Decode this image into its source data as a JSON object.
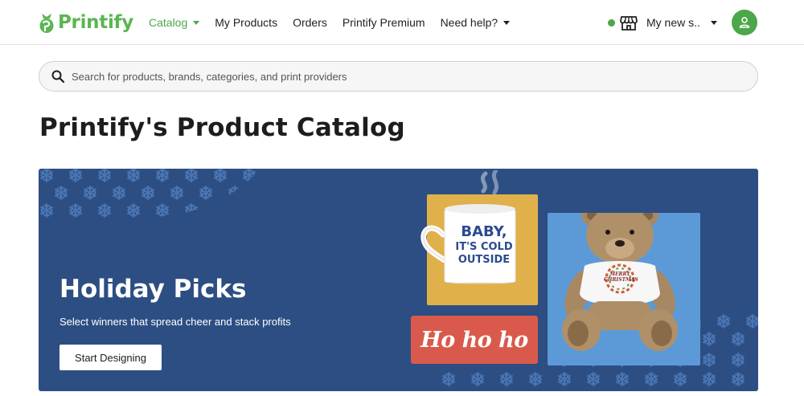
{
  "brand": {
    "name": "Printify",
    "color": "#5ab552"
  },
  "nav": {
    "items": [
      {
        "label": "Catalog",
        "has_menu": true,
        "active": true
      },
      {
        "label": "My Products",
        "has_menu": false,
        "active": false
      },
      {
        "label": "Orders",
        "has_menu": false,
        "active": false
      },
      {
        "label": "Printify Premium",
        "has_menu": false,
        "active": false
      },
      {
        "label": "Need help?",
        "has_menu": true,
        "active": false
      }
    ]
  },
  "store": {
    "name": "My new s...",
    "status_color": "#4ca74a",
    "icon": "storefront-icon"
  },
  "account": {
    "icon": "user-icon",
    "color": "#4ca74a"
  },
  "search": {
    "placeholder": "Search for products, brands, categories, and print providers",
    "value": ""
  },
  "page": {
    "title": "Printify's Product Catalog"
  },
  "banner": {
    "title": "Holiday Picks",
    "subtitle": "Select winners that spread cheer and stack profits",
    "cta_label": "Start Designing",
    "background": "#2d4e83",
    "mug_text": [
      "BABY,",
      "IT'S COLD",
      "OUTSIDE"
    ],
    "hoho_text": "Ho ho ho",
    "bear_shirt_text": [
      "MERRY",
      "CHRISTMAS"
    ]
  }
}
